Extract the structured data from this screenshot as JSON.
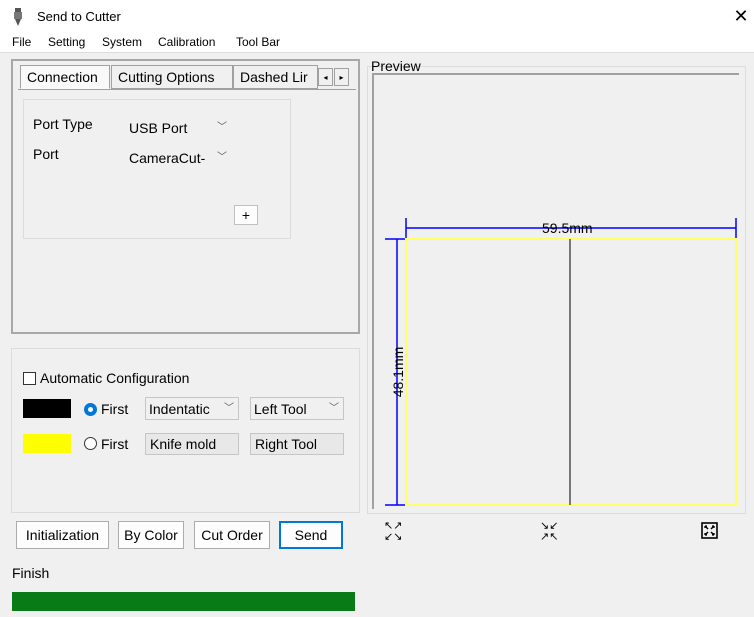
{
  "window": {
    "title": "Send to Cutter",
    "close_icon": "close-icon"
  },
  "menu": [
    "File",
    "Setting",
    "System",
    "Calibration",
    "Tool Bar"
  ],
  "tabs": {
    "items": [
      "Connection",
      "Cutting Options",
      "Dashed Lir"
    ],
    "active": "Connection",
    "scroll_left": "◂",
    "scroll_right": "▸"
  },
  "connection": {
    "port_type_label": "Port Type",
    "port_type_value": "USB Port",
    "port_label": "Port",
    "port_value": "CameraCut-",
    "add_label": "+"
  },
  "auto_config": {
    "label": "Automatic Configuration",
    "checked": false
  },
  "layers": [
    {
      "color": "#000000",
      "selected": true,
      "first_label": "First",
      "mode": "Indentatic",
      "tool": "Left Tool"
    },
    {
      "color": "#ffff00",
      "selected": false,
      "first_label": "First",
      "mode": "Knife mold",
      "tool": "Right Tool"
    }
  ],
  "buttons": {
    "initialization": "Initialization",
    "by_color": "By Color",
    "cut_order": "Cut Order",
    "send": "Send"
  },
  "status": {
    "text": "Finish",
    "progress": 1.0,
    "progress_color": "#087a16"
  },
  "preview": {
    "label": "Preview",
    "width_dim": "59.5mm",
    "height_dim": "48.1mm",
    "frame_color": "#ffff66",
    "dimension_color": "#0000ff",
    "controls": [
      "expand-icon",
      "collapse-icon",
      "fit-icon"
    ]
  }
}
